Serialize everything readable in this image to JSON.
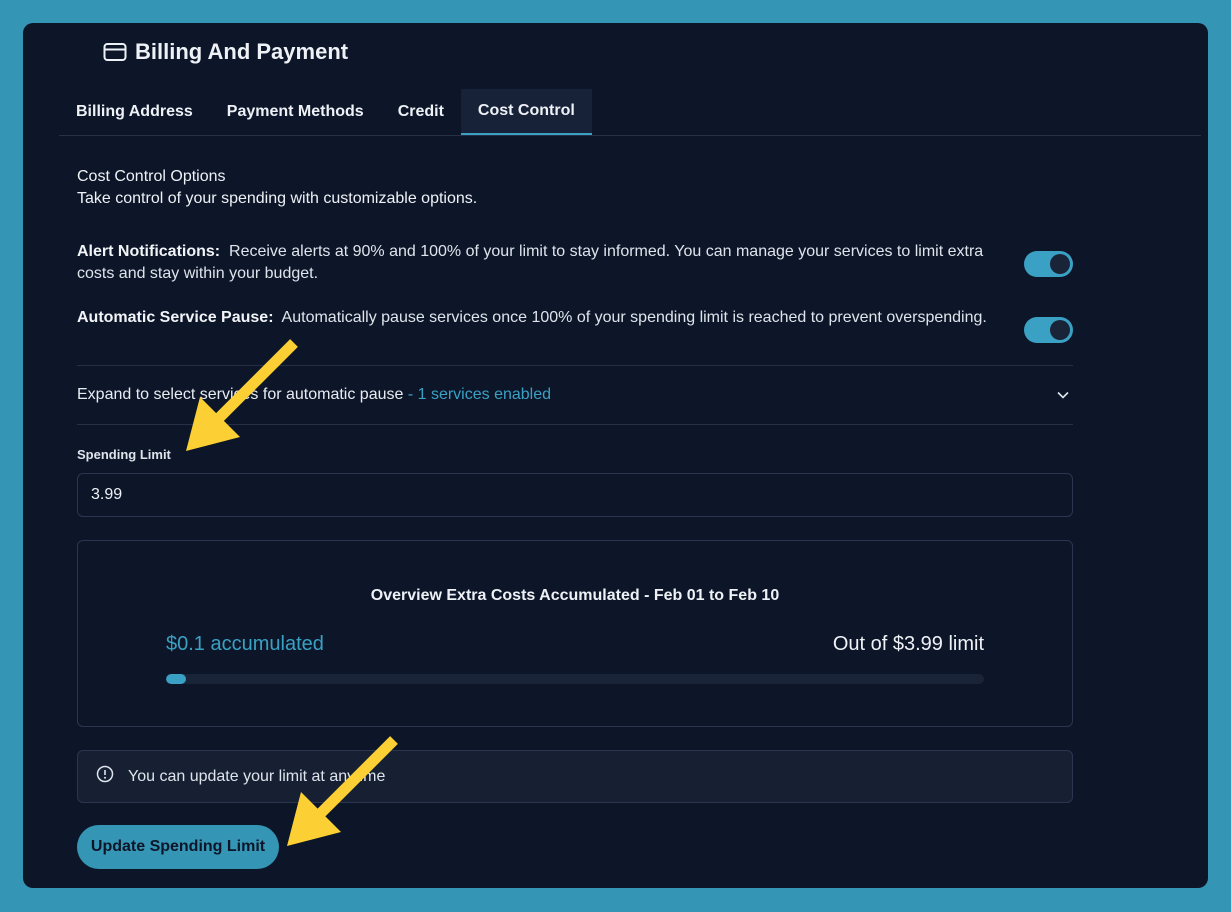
{
  "colors": {
    "background": "#3595b5",
    "panel": "#0d1628",
    "accent": "#3aa0c4",
    "annotation_arrow": "#fcd034"
  },
  "header": {
    "icon": "credit-card-icon",
    "title": "Billing And Payment"
  },
  "tabs": [
    {
      "label": "Billing Address",
      "active": false
    },
    {
      "label": "Payment Methods",
      "active": false
    },
    {
      "label": "Credit",
      "active": false
    },
    {
      "label": "Cost Control",
      "active": true
    }
  ],
  "intro": {
    "title": "Cost Control Options",
    "subtitle": "Take control of your spending with customizable options."
  },
  "options": {
    "alerts": {
      "label": "Alert Notifications:",
      "description": "Receive alerts at 90% and 100% of your limit to stay informed. You can manage your services to limit extra costs and stay within your budget.",
      "enabled": true
    },
    "pause": {
      "label": "Automatic Service Pause:",
      "description": "Automatically pause services once 100% of your spending limit is reached to prevent overspending.",
      "enabled": true
    }
  },
  "expand": {
    "text": "Expand to select services for automatic pause",
    "status": " - 1 services enabled",
    "icon": "chevron-down-icon"
  },
  "spending_limit": {
    "label": "Spending Limit",
    "value": "3.99"
  },
  "overview": {
    "title": "Overview Extra Costs Accumulated - Feb 01 to Feb 10",
    "accumulated_text": "$0.1 accumulated",
    "limit_text": "Out of $3.99 limit",
    "progress_fraction": 0.025
  },
  "info": {
    "icon": "info-circle-icon",
    "text": "You can update your limit at anytime"
  },
  "update_button": {
    "label": "Update Spending Limit"
  }
}
